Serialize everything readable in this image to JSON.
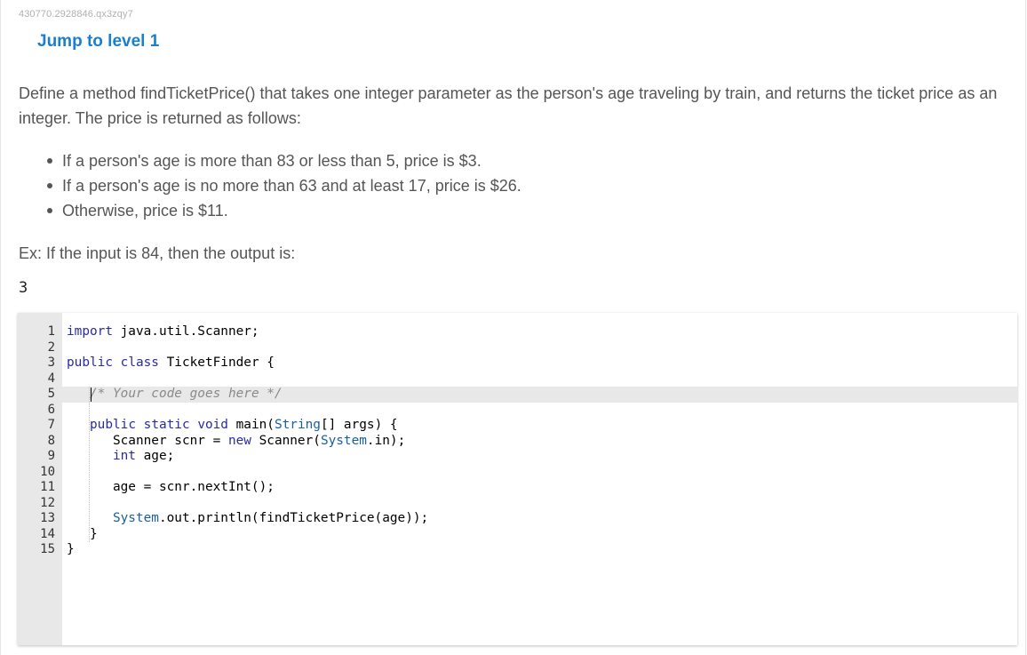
{
  "header": {
    "problem_id": "430770.2928846.qx3zqy7",
    "jump_link": "Jump to level 1"
  },
  "description": {
    "intro": "Define a method findTicketPrice() that takes one integer parameter as the person's age traveling by train, and returns the ticket price as an integer. The price is returned as follows:",
    "bullets": [
      "If a person's age is more than 83 or less than 5, price is $3.",
      "If a person's age is no more than 63 and at least 17, price is $26.",
      "Otherwise, price is $11."
    ],
    "example_text": "Ex: If the input is 84, then the output is:",
    "example_output": "3"
  },
  "editor": {
    "active_line": 5,
    "lines": [
      {
        "n": "1",
        "code": "import java.util.Scanner;"
      },
      {
        "n": "2",
        "code": ""
      },
      {
        "n": "3",
        "code": "public class TicketFinder {"
      },
      {
        "n": "4",
        "code": ""
      },
      {
        "n": "5",
        "code": "   /* Your code goes here */"
      },
      {
        "n": "6",
        "code": ""
      },
      {
        "n": "7",
        "code": "   public static void main(String[] args) {"
      },
      {
        "n": "8",
        "code": "      Scanner scnr = new Scanner(System.in);"
      },
      {
        "n": "9",
        "code": "      int age;"
      },
      {
        "n": "10",
        "code": ""
      },
      {
        "n": "11",
        "code": "      age = scnr.nextInt();"
      },
      {
        "n": "12",
        "code": ""
      },
      {
        "n": "13",
        "code": "      System.out.println(findTicketPrice(age));"
      },
      {
        "n": "14",
        "code": "   }"
      },
      {
        "n": "15",
        "code": "}"
      }
    ]
  }
}
